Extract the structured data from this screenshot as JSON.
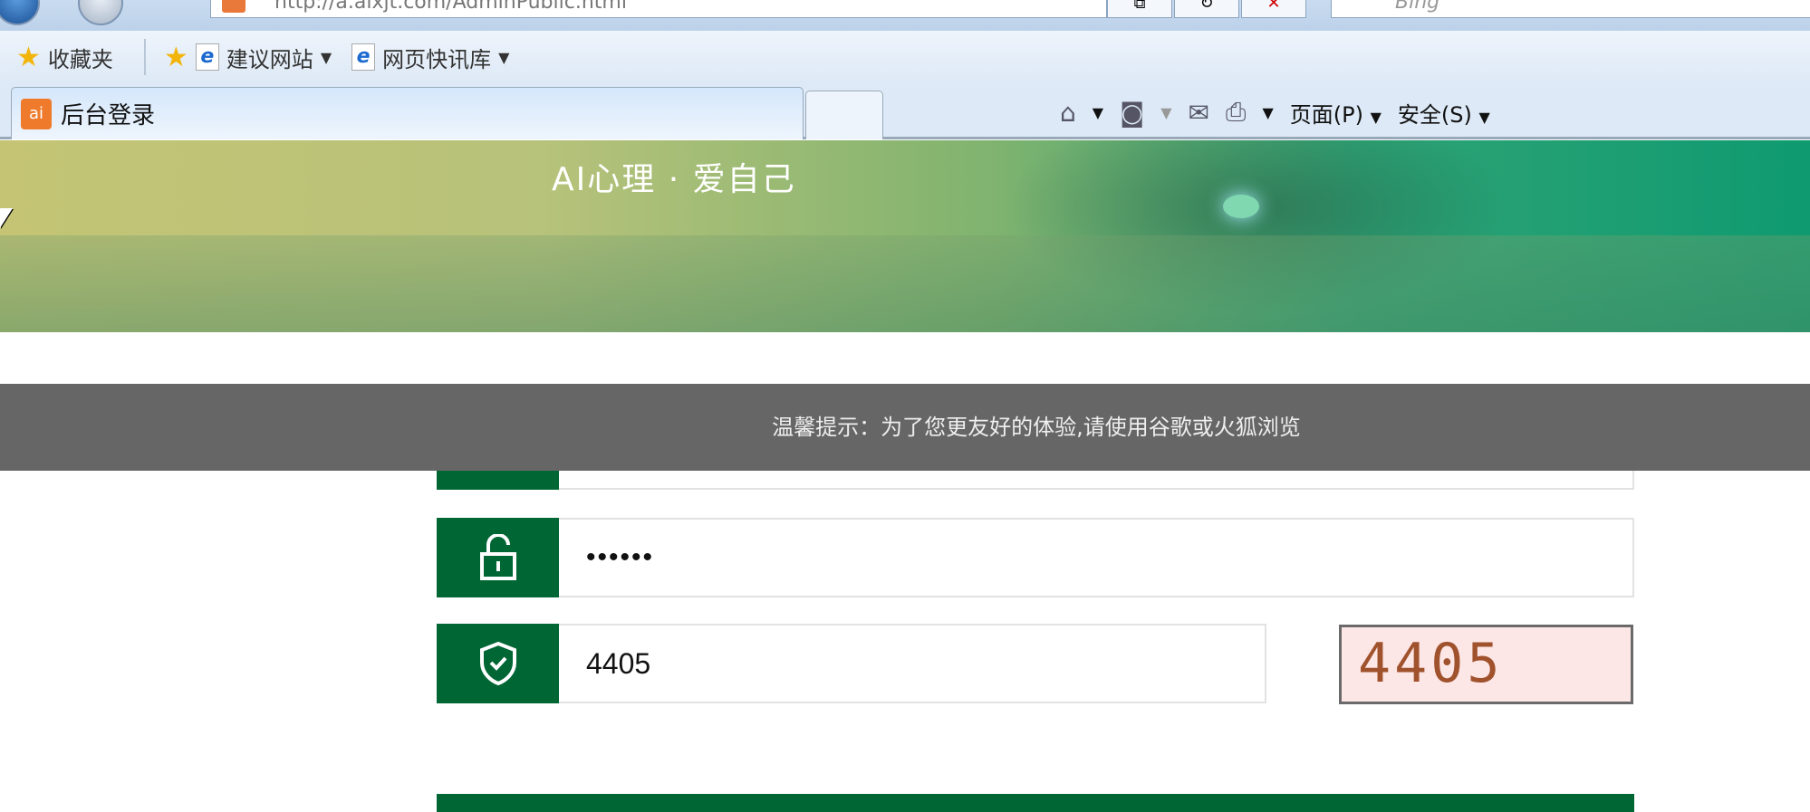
{
  "browser": {
    "address": "http://a.aixjt.com/AdminPublic.html",
    "search_engine": "Bing",
    "favorites_label": "收藏夹",
    "favorites_items": [
      "建议网站",
      "网页快讯库"
    ],
    "tab_title": "后台登录",
    "commands": {
      "page": "页面(P)",
      "safety": "安全(S)"
    }
  },
  "banner": {
    "slogan": "AI心理 · 爱自己"
  },
  "notice": "温馨提示：为了您更友好的体验,请使用谷歌或火狐浏览",
  "form": {
    "username_value": "",
    "password_mask": "••••••",
    "captcha_value": "4405",
    "captcha_image_text": "4405"
  },
  "colors": {
    "brand": "#006633",
    "notice_bg": "#666666"
  }
}
